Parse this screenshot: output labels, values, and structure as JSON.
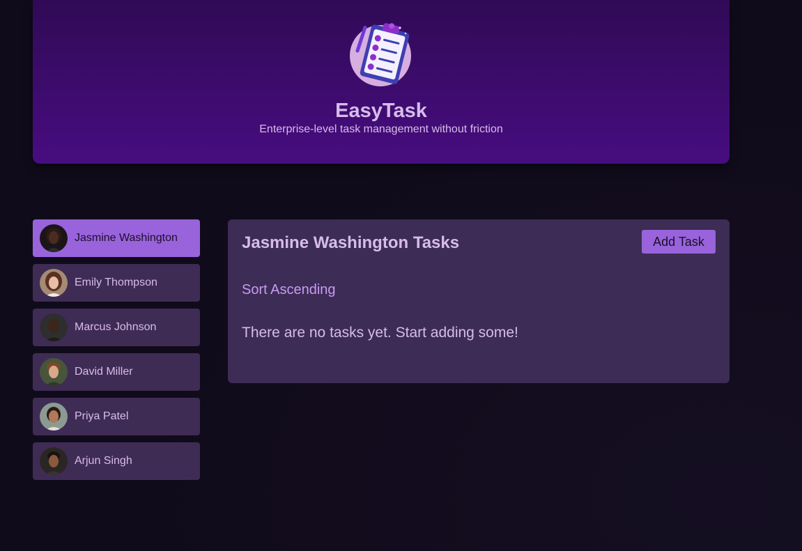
{
  "header": {
    "logo_icon": "clipboard-checklist-icon",
    "title": "EasyTask",
    "subtitle": "Enterprise-level task management without friction"
  },
  "users": [
    {
      "name": "Jasmine Washington",
      "active": true,
      "avatar": "avatar-jasmine"
    },
    {
      "name": "Emily Thompson",
      "active": false,
      "avatar": "avatar-emily"
    },
    {
      "name": "Marcus Johnson",
      "active": false,
      "avatar": "avatar-marcus"
    },
    {
      "name": "David Miller",
      "active": false,
      "avatar": "avatar-david"
    },
    {
      "name": "Priya Patel",
      "active": false,
      "avatar": "avatar-priya"
    },
    {
      "name": "Arjun Singh",
      "active": false,
      "avatar": "avatar-arjun"
    }
  ],
  "tasks_panel": {
    "title": "Jasmine Washington Tasks",
    "add_task_label": "Add Task",
    "sort_label": "Sort Ascending",
    "empty_message": "There are no tasks yet. Start adding some!"
  },
  "colors": {
    "accent": "#9963dc",
    "text": "#d7bce8",
    "panel": "#3d2c55",
    "background": "#100b1a"
  }
}
